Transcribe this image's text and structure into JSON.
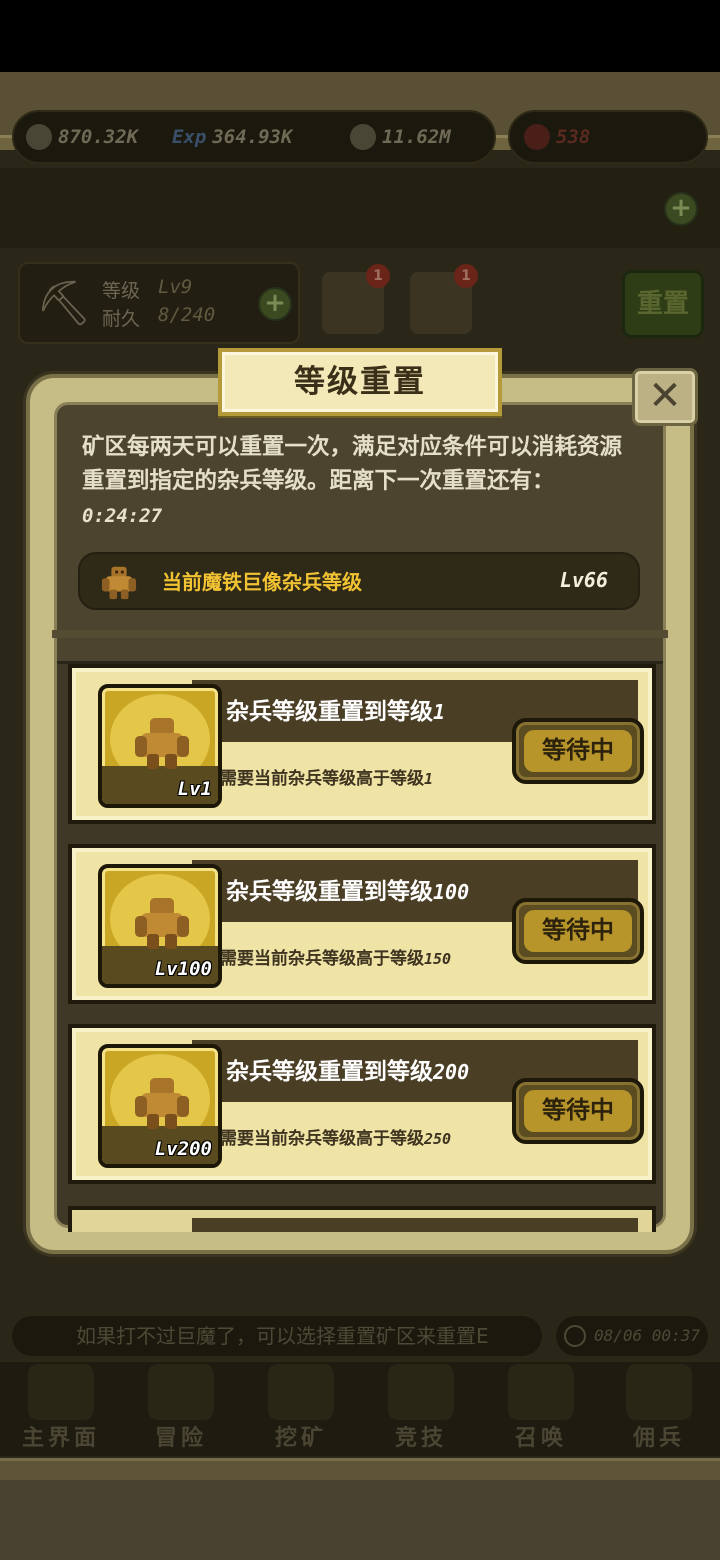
{
  "resources": {
    "attack": "870.32K",
    "exp_label": "Exp",
    "exp": "364.93K",
    "gold": "11.62M",
    "gems": "538"
  },
  "pickaxe": {
    "level_label": "等级",
    "level_value": "Lv9",
    "durability_label": "耐久",
    "durability_value": "8/240"
  },
  "top_badges": [
    "1",
    "1"
  ],
  "top_reset_button": "重置",
  "modal": {
    "title": "等级重置",
    "close_symbol": "✕",
    "description": "矿区每两天可以重置一次，满足对应条件可以消耗资源重置到指定的杂兵等级。距离下一次重置还有：",
    "timer": "0:24:27",
    "current_label": "当前魔铁巨像杂兵等级",
    "current_level": "Lv66",
    "options": [
      {
        "title": "杂兵等级重置到等级",
        "target": "1",
        "requirement": "需要当前杂兵等级高于等级",
        "required": "1",
        "thumb_level": "Lv1",
        "button": "等待中"
      },
      {
        "title": "杂兵等级重置到等级",
        "target": "100",
        "requirement": "需要当前杂兵等级高于等级",
        "required": "150",
        "thumb_level": "Lv100",
        "button": "等待中"
      },
      {
        "title": "杂兵等级重置到等级",
        "target": "200",
        "requirement": "需要当前杂兵等级高于等级",
        "required": "250",
        "thumb_level": "Lv200",
        "button": "等待中"
      }
    ]
  },
  "ticker": {
    "text": "如果打不过巨魔了，可以选择重置矿区来重置E",
    "time": "08/06 00:37"
  },
  "nav": [
    "主界面",
    "冒险",
    "挖矿",
    "竞技",
    "召唤",
    "佣兵"
  ]
}
